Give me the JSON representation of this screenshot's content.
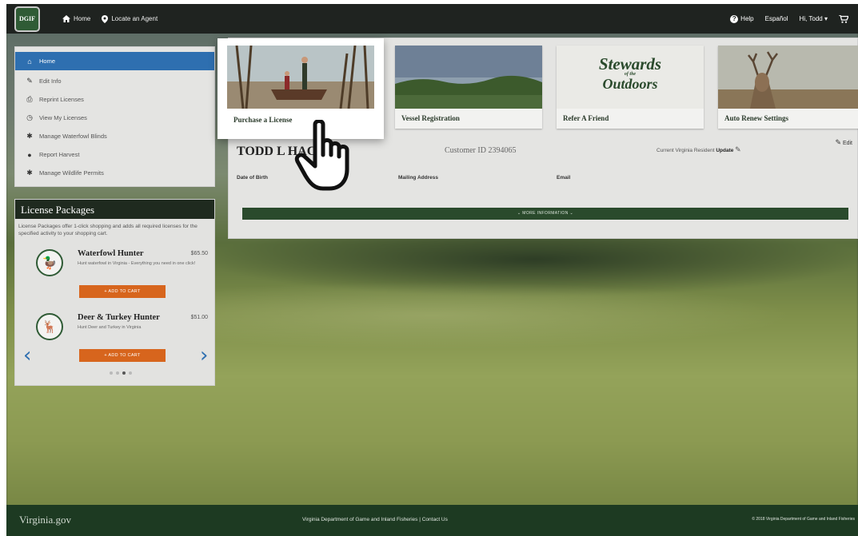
{
  "topbar": {
    "logo_text": "DGIF",
    "home_label": "Home",
    "locate_agent_label": "Locate an Agent",
    "help_label": "Help",
    "language_label": "Español",
    "user_label": "Hi, Todd ▾"
  },
  "sidebar": {
    "items": [
      {
        "label": "Home",
        "icon": "home-icon"
      },
      {
        "label": "Edit Info",
        "icon": "pencil-icon"
      },
      {
        "label": "Reprint Licenses",
        "icon": "printer-icon"
      },
      {
        "label": "View My Licenses",
        "icon": "history-icon"
      },
      {
        "label": "Manage Waterfowl Blinds",
        "icon": "gear-icon"
      },
      {
        "label": "Report Harvest",
        "icon": "info-icon"
      },
      {
        "label": "Manage Wildlife Permits",
        "icon": "gear-icon"
      }
    ]
  },
  "packages": {
    "title": "License Packages",
    "description": "License Packages offer 1-click shopping and adds all required licenses for the specified activity to your shopping cart.",
    "items": [
      {
        "title": "Waterfowl Hunter",
        "price": "$65.50",
        "subtitle": "Hunt waterfowl in Virginia - Everything you need in one click!",
        "button": "+ ADD TO CART"
      },
      {
        "title": "Deer & Turkey Hunter",
        "price": "$51.00",
        "subtitle": "Hunt Deer and Turkey in Virginia",
        "button": "+ ADD TO CART"
      }
    ]
  },
  "tiles": [
    {
      "label": "Purchase a License"
    },
    {
      "label": "Vessel Registration"
    },
    {
      "label": "Refer A Friend",
      "logo_line1": "Stewards",
      "logo_line2": "of the",
      "logo_line3": "Outdoors"
    },
    {
      "label": "Auto Renew Settings"
    }
  ],
  "customer": {
    "name": "TODD L HAC",
    "customer_id": "Customer ID 2394065",
    "resident_text": "Current Virginia Resident",
    "update_label": "Update",
    "edit_label": "Edit",
    "dob_label": "Date of Birth",
    "mailing_label": "Mailing Address",
    "email_label": "Email",
    "more_info_label": "⌄ MORE INFORMATION ⌄"
  },
  "footer": {
    "site": "Virginia.gov",
    "dept": "Virginia Department of Game and Inland Fisheries",
    "contact": "Contact Us",
    "copyright": "© 2018 Virginia Department of Game and Inland Fisheries"
  },
  "colors": {
    "accent_blue": "#2e6fb0",
    "brand_green": "#2a4a2c",
    "cart_orange": "#d7651d",
    "topbar": "#1f2320"
  }
}
